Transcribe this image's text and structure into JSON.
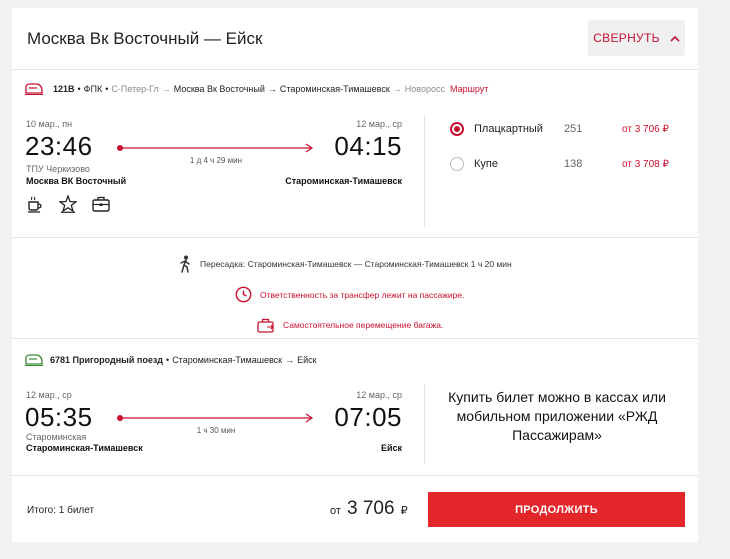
{
  "header": {
    "title": "Москва Вк Восточный — Ейск",
    "collapse_label": "СВЕРНУТЬ"
  },
  "segment1": {
    "train_number": "121В",
    "carrier": "ФПК",
    "route_part1": "С-Петер-Гл",
    "route_part2": "Москва Вк Восточный",
    "route_part3": "Староминская-Тимашевск",
    "route_part4": "Новоросс",
    "route_link": "Маршрут",
    "dep_date": "10 мар., пн",
    "dep_time": "23:46",
    "dep_station_small": "ТПУ Черкизово",
    "dep_station": "Москва ВК Восточный",
    "duration": "1 д 4 ч 29 мин",
    "arr_date": "12 мар., ср",
    "arr_time": "04:15",
    "arr_station": "Староминская-Тимашевск",
    "amenities": [
      "coffee-icon",
      "star-icon",
      "luggage-icon"
    ],
    "fares": [
      {
        "class": "Плацкартный",
        "seats": "251",
        "price": "от 3 706 ₽",
        "selected": true
      },
      {
        "class": "Купе",
        "seats": "138",
        "price": "от 3 708 ₽",
        "selected": false
      }
    ]
  },
  "transfer": {
    "text": "Пересадка: Староминская-Тимашевск — Староминская-Тимашевск 1 ч 20 мин",
    "warning1": "Ответственность за трансфер лежит на пассажире.",
    "warning2": "Самостоятельное перемещение багажа."
  },
  "segment2": {
    "train_line": "6781 Пригородный поезд",
    "route_from": "Староминская-Тимашевск",
    "route_to": "Ейск",
    "dep_date": "12 мар., ср",
    "dep_time": "05:35",
    "dep_station_small": "Староминская",
    "dep_station": "Староминская-Тимашевск",
    "duration": "1 ч 30 мин",
    "arr_date": "12 мар., ср",
    "arr_time": "07:05",
    "arr_station": "Ейск",
    "buy_info": "Купить билет можно в кассах или мобильном приложении «РЖД Пассажирам»"
  },
  "footer": {
    "total_label": "Итого: 1 билет",
    "price_prefix": "от",
    "price_amount": "3 706",
    "currency": "₽",
    "continue_label": "ПРОДОЛЖИТЬ"
  },
  "colors": {
    "accent": "#c8102e",
    "button": "#e3262a",
    "train_icon_green": "#3a8a3a"
  }
}
